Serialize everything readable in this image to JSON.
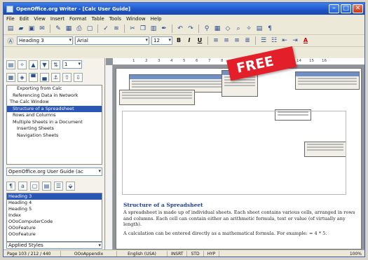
{
  "window": {
    "title": "OpenOffice.org Writer - [Calc User Guide]"
  },
  "menu": [
    "File",
    "Edit",
    "View",
    "Insert",
    "Format",
    "Table",
    "Tools",
    "Window",
    "Help"
  ],
  "format_bar": {
    "style": "Heading 3",
    "font": "Arial",
    "size": "12"
  },
  "navigator": {
    "items": [
      "Exporting from Calc",
      "Referencing Data in Network",
      "The Calc Window",
      "Structure of a Spreadsheet",
      "Rows and Columns",
      "Multiple Sheets in a Document",
      "Inserting Sheets",
      "Navigation Sheets"
    ],
    "selected_index": 3,
    "document_dropdown": "OpenOffice.org User Guide (ac"
  },
  "styles": {
    "items": [
      "Heading 3",
      "Heading 4",
      "Heading 5",
      "Index",
      "OOoComputerCode",
      "OOoFeature",
      "OOoFeature"
    ],
    "selected_index": 0,
    "applied": "Applied Styles"
  },
  "ruler": [
    "1",
    "2",
    "3",
    "4",
    "5",
    "6",
    "7",
    "8",
    "9",
    "10",
    "11",
    "12",
    "13",
    "14",
    "15",
    "16"
  ],
  "document": {
    "heading": "Structure of a Spreadsheet",
    "p1": "A spreadsheet is made up of individual sheets. Each sheet contains various cells, arranged in rows and columns. Each cell can contain either an arithmetic formula, text or value (of virtually any length).",
    "p2": "A calculation can be entered directly as a mathematical formula. For example: = 4 * 5."
  },
  "promo": {
    "badge": "FREE",
    "color": "#e3202a"
  },
  "status": {
    "page": "Page 103 / 212 / 440",
    "style": "OOoAppendix",
    "lang": "English (USA)",
    "mode": "INSRT",
    "std": "STD",
    "hyp": "HYP",
    "zoom": "100%"
  }
}
